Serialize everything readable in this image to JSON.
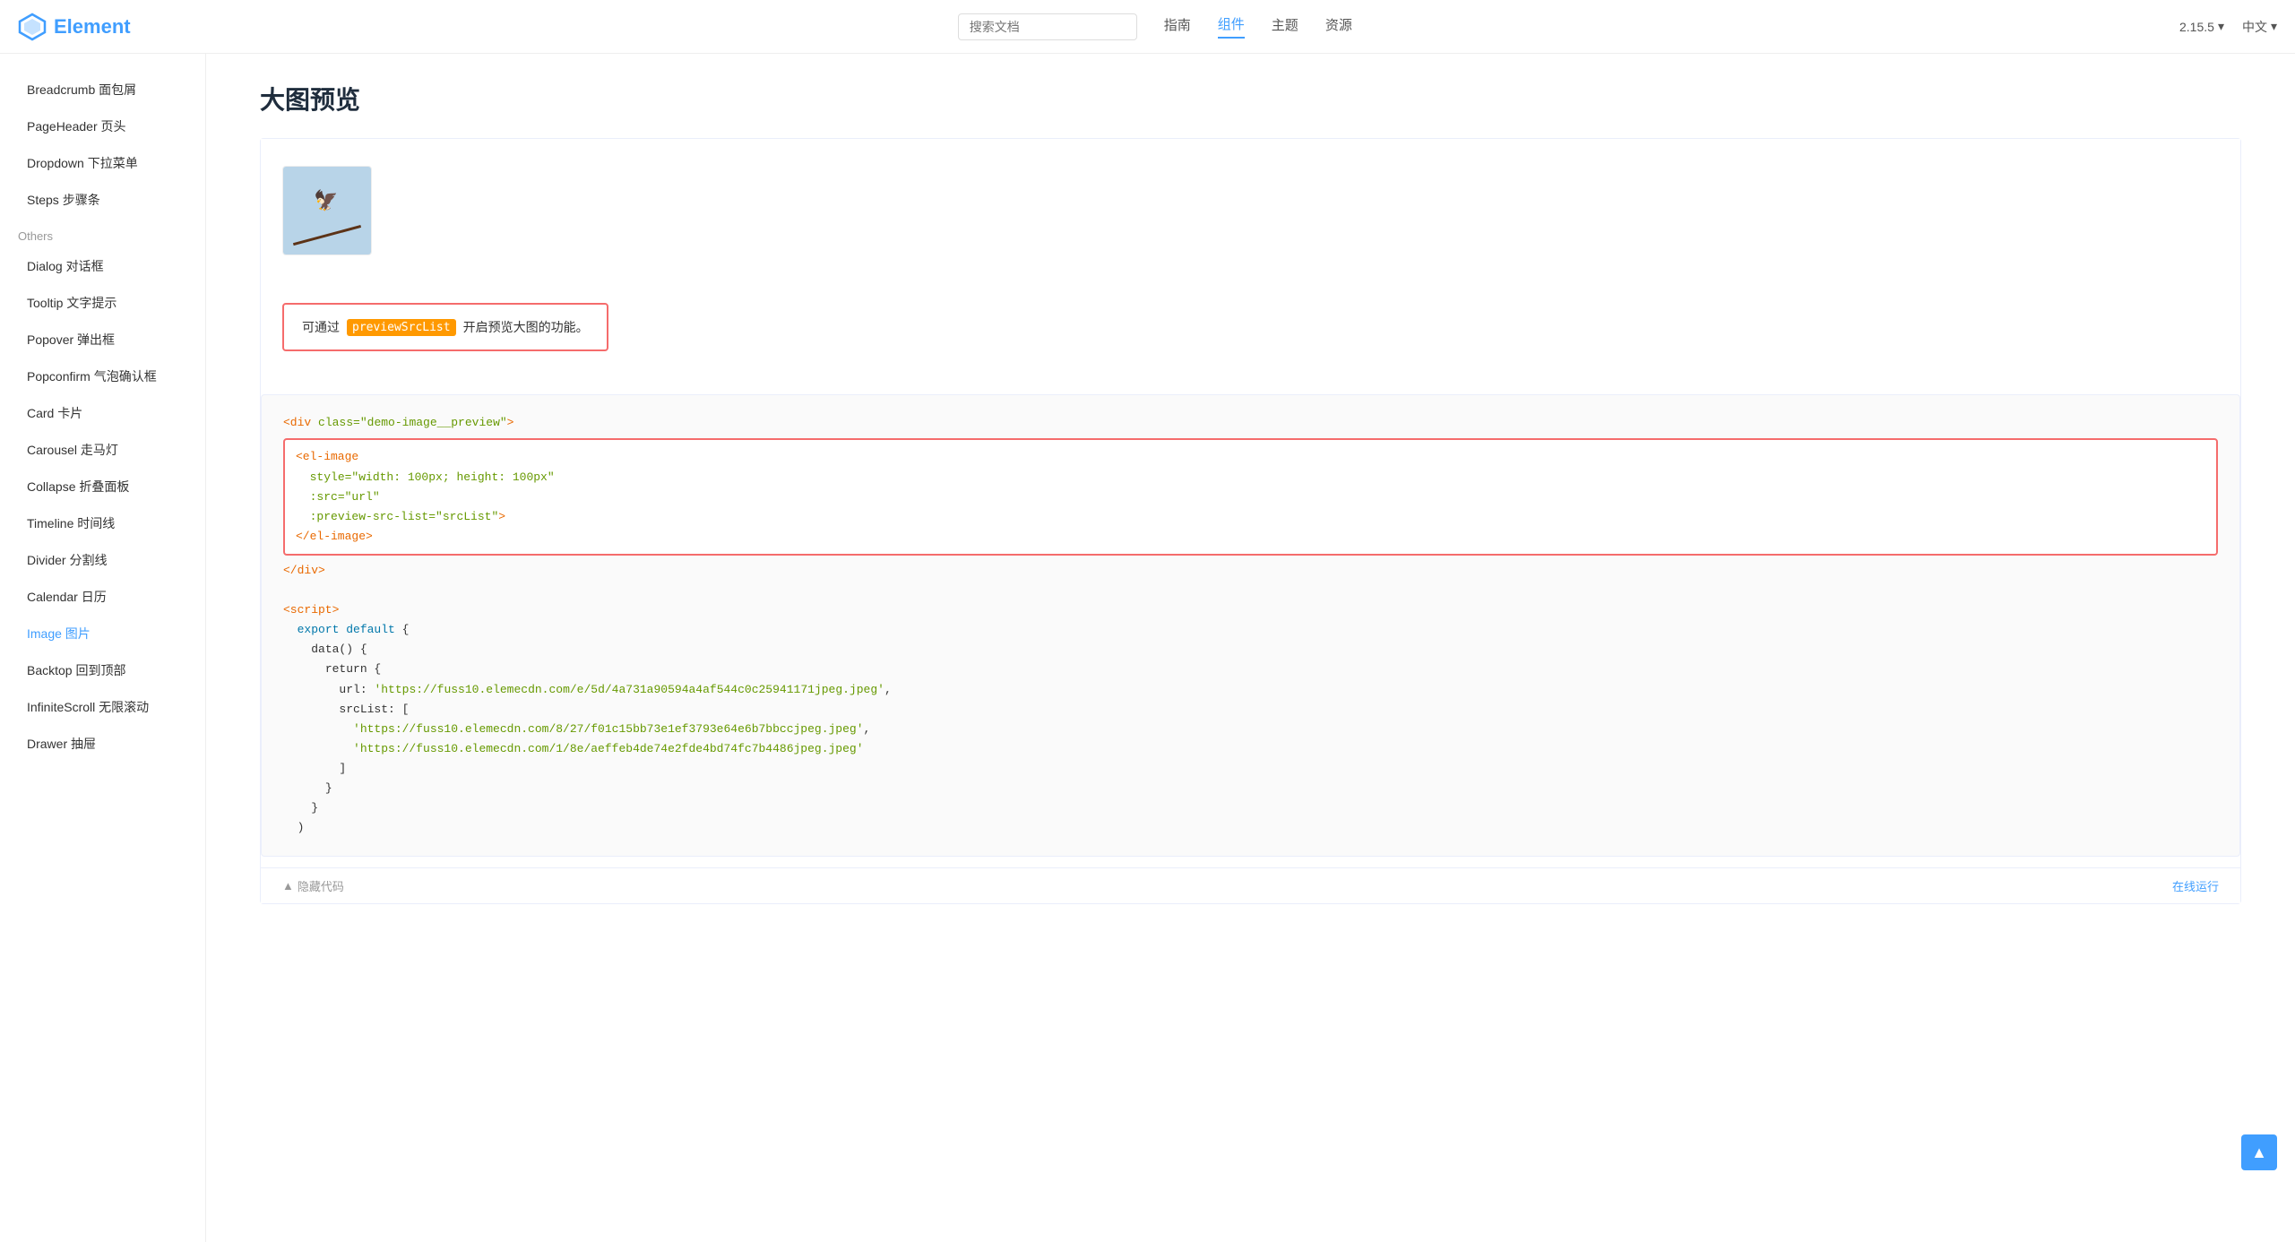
{
  "header": {
    "logo_text": "Element",
    "search_placeholder": "搜索文档",
    "nav_items": [
      {
        "label": "指南",
        "active": false
      },
      {
        "label": "组件",
        "active": true
      },
      {
        "label": "主题",
        "active": false
      },
      {
        "label": "资源",
        "active": false
      }
    ],
    "version": "2.15.5",
    "lang": "中文"
  },
  "sidebar": {
    "items": [
      {
        "label": "Breadcrumb 面包屑",
        "active": false
      },
      {
        "label": "PageHeader 页头",
        "active": false
      },
      {
        "label": "Dropdown 下拉菜单",
        "active": false
      },
      {
        "label": "Steps 步骤条",
        "active": false
      },
      {
        "section": "Others"
      },
      {
        "label": "Dialog 对话框",
        "active": false
      },
      {
        "label": "Tooltip 文字提示",
        "active": false
      },
      {
        "label": "Popover 弹出框",
        "active": false
      },
      {
        "label": "Popconfirm 气泡确认框",
        "active": false
      },
      {
        "label": "Card 卡片",
        "active": false
      },
      {
        "label": "Carousel 走马灯",
        "active": false
      },
      {
        "label": "Collapse 折叠面板",
        "active": false
      },
      {
        "label": "Timeline 时间线",
        "active": false
      },
      {
        "label": "Divider 分割线",
        "active": false
      },
      {
        "label": "Calendar 日历",
        "active": false
      },
      {
        "label": "Image 图片",
        "active": true
      },
      {
        "label": "Backtop 回到顶部",
        "active": false
      },
      {
        "label": "InfiniteScroll 无限滚动",
        "active": false
      },
      {
        "label": "Drawer 抽屉",
        "active": false
      }
    ]
  },
  "main": {
    "title": "大图预览",
    "info_text_before": "可通过",
    "info_code": "previewSrcList",
    "info_text_after": "开启预览大图的功能。",
    "code_lines": [
      {
        "type": "tag",
        "text": "<div class=\"demo-image__preview\">"
      },
      {
        "type": "highlighted",
        "lines": [
          {
            "type": "tag",
            "text": "  <el-image"
          },
          {
            "type": "attr",
            "text": "    style=\"width: 100px; height: 100px\""
          },
          {
            "type": "attr",
            "text": "    :src=\"url\""
          },
          {
            "type": "attr",
            "text": "    :preview-src-list=\"srcList\">"
          },
          {
            "type": "tag",
            "text": "  </el-image>"
          }
        ]
      },
      {
        "type": "tag",
        "text": "</div>"
      },
      {
        "type": "plain",
        "text": ""
      },
      {
        "type": "keyword",
        "text": "<script>"
      },
      {
        "type": "plain",
        "text": "  export default {"
      },
      {
        "type": "plain",
        "text": "    data() {"
      },
      {
        "type": "plain",
        "text": "      return {"
      },
      {
        "type": "string",
        "text": "        url: 'https://fuss10.elemecdn.com/e/5d/4a731a90594a4af544c0c25941171jpeg.jpeg',"
      },
      {
        "type": "plain",
        "text": "        srcList: ["
      },
      {
        "type": "string",
        "text": "          'https://fuss10.elemecdn.com/8/27/f01c15bb73e1ef3793e64e6b7bbccjpeg.jpeg',"
      },
      {
        "type": "string",
        "text": "          'https://fuss10.elemecdn.com/1/8e/aeffeb4de74e2fde4bd74fc7b4486jpeg.jpeg'"
      },
      {
        "type": "plain",
        "text": "        ]"
      },
      {
        "type": "plain",
        "text": "      }"
      },
      {
        "type": "plain",
        "text": "    }"
      },
      {
        "type": "plain",
        "text": "  )"
      }
    ],
    "footer": {
      "collapse_label": "隐藏代码",
      "run_label": "在线运行"
    }
  },
  "scroll_top_icon": "▲"
}
